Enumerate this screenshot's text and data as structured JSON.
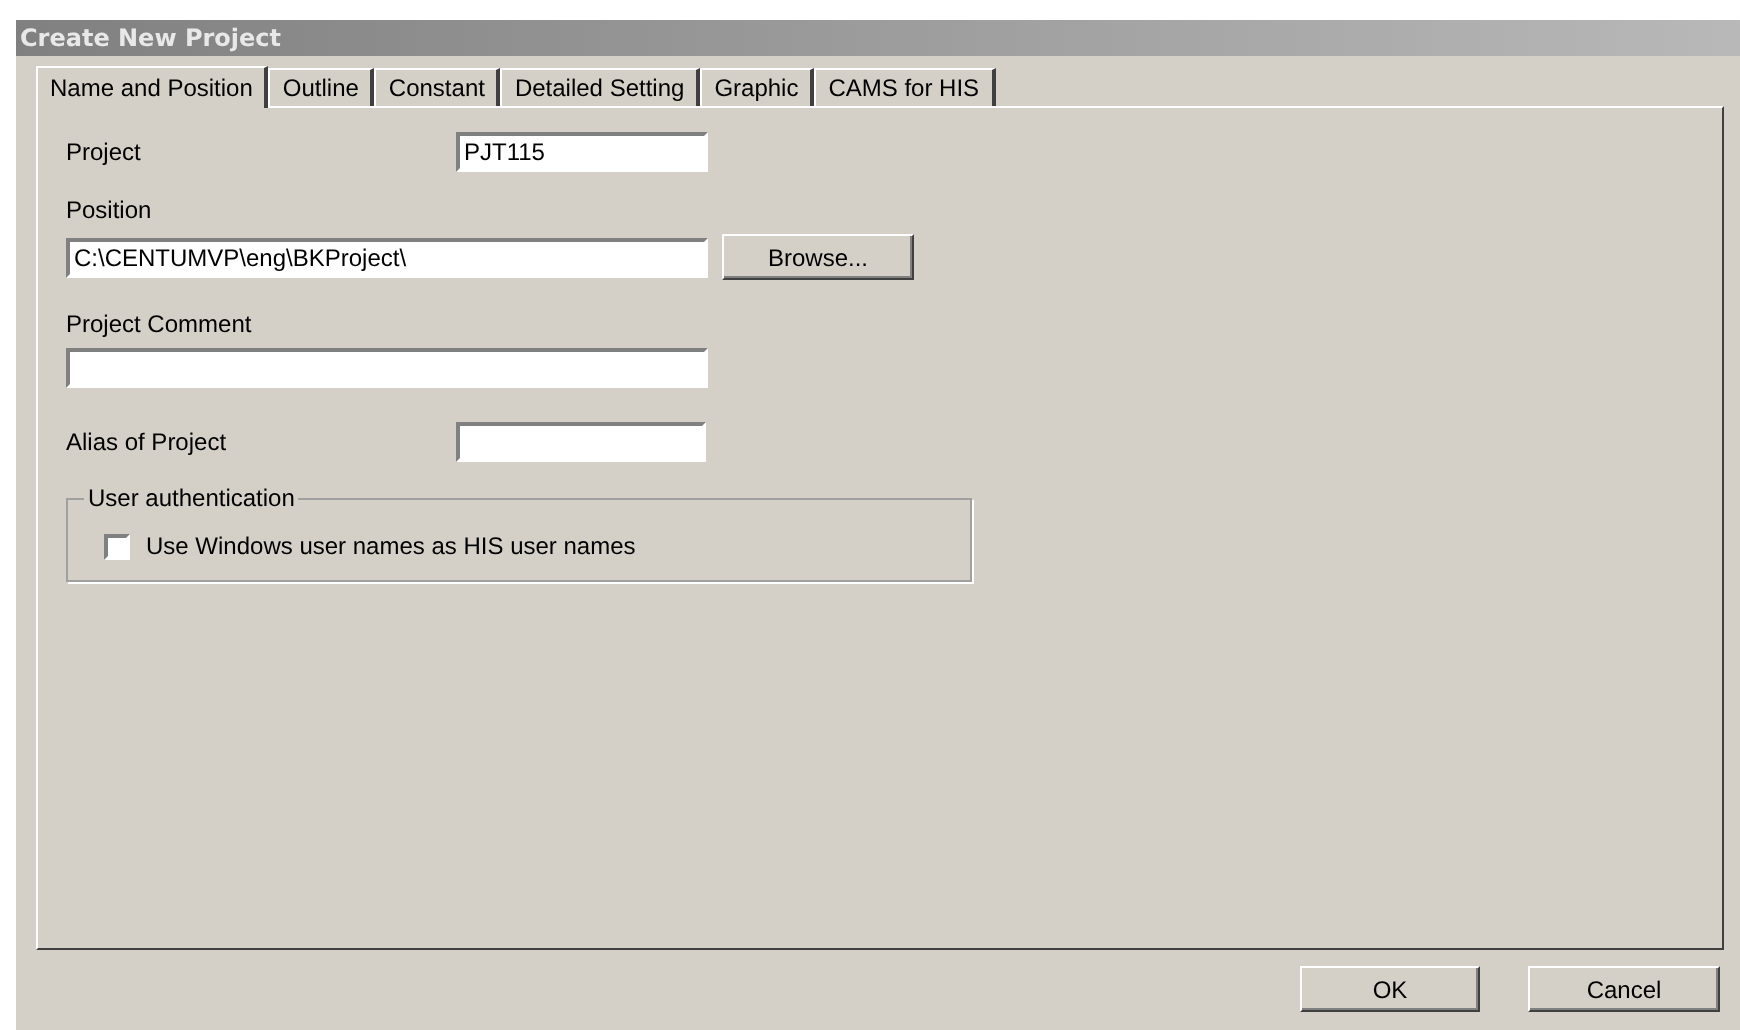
{
  "window": {
    "title": "Create New Project"
  },
  "tabs": [
    {
      "label": "Name and Position",
      "selected": true
    },
    {
      "label": "Outline",
      "selected": false
    },
    {
      "label": "Constant",
      "selected": false
    },
    {
      "label": "Detailed Setting",
      "selected": false
    },
    {
      "label": "Graphic",
      "selected": false
    },
    {
      "label": "CAMS for HIS",
      "selected": false
    }
  ],
  "project": {
    "label": "Project",
    "value": "PJT115"
  },
  "position": {
    "label": "Position",
    "value": "C:\\CENTUMVP\\eng\\BKProject\\",
    "browse": "Browse..."
  },
  "comment": {
    "label": "Project Comment"
  },
  "alias": {
    "label": "Alias of Project"
  },
  "user_auth": {
    "title": "User authentication",
    "checkbox": {
      "label": "Use Windows user names as HIS user names",
      "checked": false
    }
  },
  "buttons": [
    "OK",
    "Cancel"
  ]
}
